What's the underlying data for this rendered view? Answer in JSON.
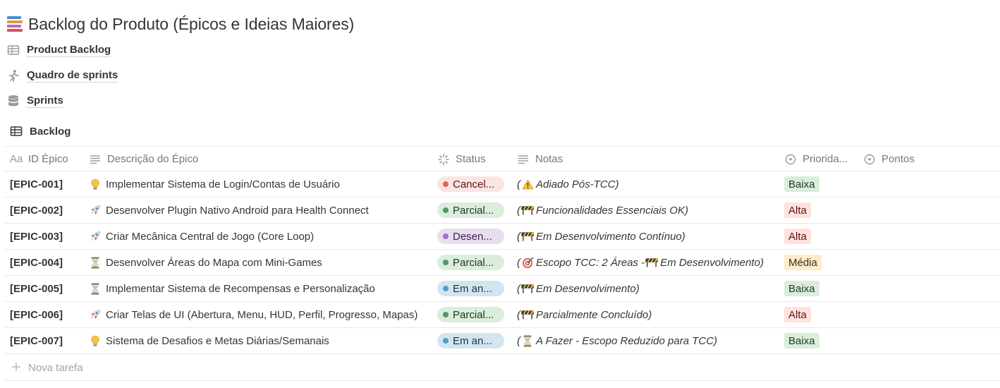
{
  "page": {
    "title": "Backlog do Produto (Épicos e Ideias Maiores)",
    "icon": "books-icon"
  },
  "links": [
    {
      "label": "Product Backlog",
      "icon": "table-icon"
    },
    {
      "label": "Quadro de sprints",
      "icon": "runner-icon"
    },
    {
      "label": "Sprints",
      "icon": "database-icon"
    }
  ],
  "view": {
    "label": "Backlog",
    "icon": "table-icon"
  },
  "table": {
    "columns": [
      {
        "label": "ID Épico",
        "icon": "title-aa-icon"
      },
      {
        "label": "Descrição do Épico",
        "icon": "text-lines-icon"
      },
      {
        "label": "Status",
        "icon": "status-spinner-icon"
      },
      {
        "label": "Notas",
        "icon": "text-lines-icon"
      },
      {
        "label": "Priorida...",
        "icon": "select-circle-icon"
      },
      {
        "label": "Pontos",
        "icon": "select-circle-icon"
      }
    ],
    "rows": [
      {
        "id": "[EPIC-001]",
        "desc_icon": "lightbulb-icon",
        "desc": "Implementar Sistema de Login/Contas de Usuário",
        "status": "Cancel...",
        "status_color": "red",
        "notes_prefix": "(",
        "notes_icon": "warning-icon",
        "notes": "Adiado Pós-TCC)",
        "notes_icon2": "",
        "notes_tail": "",
        "priority": "Baixa",
        "priority_color": "green"
      },
      {
        "id": "[EPIC-002]",
        "desc_icon": "rocket-icon",
        "desc": "Desenvolver Plugin Nativo Android para Health Connect",
        "status": "Parcial...",
        "status_color": "green",
        "notes_prefix": "(",
        "notes_icon": "construction-icon",
        "notes": "Funcionalidades Essenciais OK)",
        "notes_icon2": "",
        "notes_tail": "",
        "priority": "Alta",
        "priority_color": "red"
      },
      {
        "id": "[EPIC-003]",
        "desc_icon": "rocket-icon",
        "desc": "Criar Mecânica Central de Jogo (Core Loop)",
        "status": "Desen...",
        "status_color": "purple",
        "notes_prefix": "(",
        "notes_icon": "construction-icon",
        "notes": "Em Desenvolvimento Contínuo)",
        "notes_icon2": "",
        "notes_tail": "",
        "priority": "Alta",
        "priority_color": "red"
      },
      {
        "id": "[EPIC-004]",
        "desc_icon": "hourglass-icon",
        "desc": "Desenvolver Áreas do Mapa com Mini-Games",
        "status": "Parcial...",
        "status_color": "green",
        "notes_prefix": "(",
        "notes_icon": "target-icon",
        "notes": "Escopo TCC: 2 Áreas -",
        "notes_icon2": "construction-icon",
        "notes_tail": "Em Desenvolvimento)",
        "priority": "Média",
        "priority_color": "yellow"
      },
      {
        "id": "[EPIC-005]",
        "desc_icon": "hourglass-icon",
        "desc": "Implementar Sistema de Recompensas e Personalização",
        "status": "Em an...",
        "status_color": "blue",
        "notes_prefix": "(",
        "notes_icon": "construction-icon",
        "notes": "Em Desenvolvimento)",
        "notes_icon2": "",
        "notes_tail": "",
        "priority": "Baixa",
        "priority_color": "green"
      },
      {
        "id": "[EPIC-006]",
        "desc_icon": "rocket-icon",
        "desc": "Criar Telas de UI (Abertura, Menu, HUD, Perfil, Progresso, Mapas)",
        "status": "Parcial...",
        "status_color": "green",
        "notes_prefix": "(",
        "notes_icon": "construction-icon",
        "notes": "Parcialmente Concluído)",
        "notes_icon2": "",
        "notes_tail": "",
        "priority": "Alta",
        "priority_color": "red"
      },
      {
        "id": "[EPIC-007]",
        "desc_icon": "lightbulb-icon",
        "desc": "Sistema de Desafios e Metas Diárias/Semanais",
        "status": "Em an...",
        "status_color": "blue",
        "notes_prefix": "(",
        "notes_icon": "hourglass-icon",
        "notes": "A Fazer - Escopo Reduzido para TCC)",
        "notes_icon2": "",
        "notes_tail": "",
        "priority": "Baixa",
        "priority_color": "green"
      }
    ],
    "new_row_label": "Nova tarefa"
  },
  "colors": {
    "status": {
      "red": {
        "bg": "#fbe4e4",
        "dot": "#e16259",
        "text": "#5d1715"
      },
      "green": {
        "bg": "#dbeddb",
        "dot": "#4f9768",
        "text": "#1c3829"
      },
      "purple": {
        "bg": "#e8deee",
        "dot": "#9a6dd7",
        "text": "#412454"
      },
      "blue": {
        "bg": "#d3e5ef",
        "dot": "#529cca",
        "text": "#183347"
      }
    },
    "priority": {
      "green": {
        "bg": "#dbeddb",
        "text": "#1c3829"
      },
      "red": {
        "bg": "#ffe2dd",
        "text": "#5d1715"
      },
      "yellow": {
        "bg": "#fdecc8",
        "text": "#402c1b"
      }
    }
  }
}
